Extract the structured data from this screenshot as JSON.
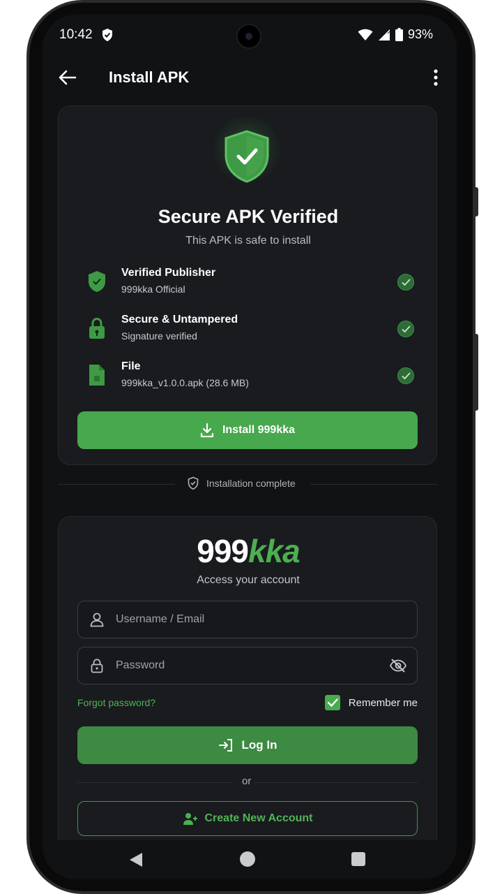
{
  "status_bar": {
    "time": "10:42",
    "battery_percent": "93%"
  },
  "app_bar": {
    "title": "Install APK"
  },
  "verify_card": {
    "title": "Secure APK Verified",
    "subtitle": "This APK is safe to install",
    "items": [
      {
        "title": "Verified Publisher",
        "detail": "999kka Official",
        "icon": "shield-icon"
      },
      {
        "title": "Secure & Untampered",
        "detail": "Signature verified",
        "icon": "lock-icon"
      },
      {
        "title": "File",
        "detail": "999kka_v1.0.0.apk (28.6 MB)",
        "icon": "file-icon"
      }
    ],
    "install_label": "Install 999kka"
  },
  "divider": {
    "text": "Installation complete"
  },
  "login_card": {
    "logo_white": "999",
    "logo_green": "kka",
    "tagline": "Access your account",
    "username_placeholder": "Username / Email",
    "password_placeholder": "Password",
    "forgot_label": "Forgot password?",
    "remember_label": "Remember me",
    "remember_checked": true,
    "login_label": "Log In",
    "or_text": "or",
    "create_label": "Create New Account"
  },
  "colors": {
    "accent": "#4caf50",
    "background": "#101214",
    "card": "#191b1e"
  }
}
